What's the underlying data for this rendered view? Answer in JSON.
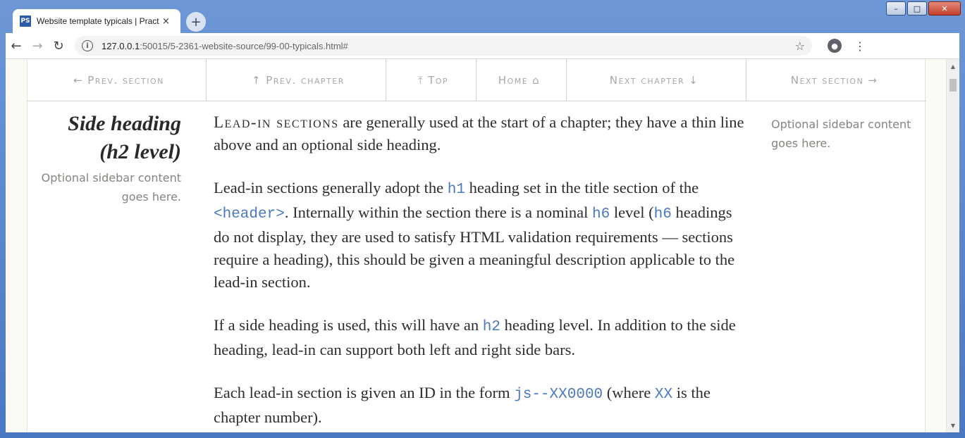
{
  "browser": {
    "tab": {
      "favicon": "PS",
      "title": "Website template typicals | Practi",
      "close": "×"
    },
    "new_tab": "+",
    "window_controls": {
      "minimize": "–",
      "maximize": "□",
      "close": "✕"
    },
    "nav": {
      "back": "←",
      "forward": "→",
      "reload": "↻"
    },
    "url_host": "127.0.0.1",
    "url_rest": ":50015/5-2361-website-source/99-00-typicals.html#",
    "icons": [
      "info-icon",
      "star-icon",
      "account-icon",
      "menu-icon"
    ]
  },
  "page_nav": [
    {
      "label": "Prev. section",
      "arrow_before": "←",
      "arrow_after": ""
    },
    {
      "label": "Prev. chapter",
      "arrow_before": "↑",
      "arrow_after": ""
    },
    {
      "label": "Top",
      "arrow_before": "⤒",
      "arrow_after": ""
    },
    {
      "label": "Home",
      "arrow_before": "",
      "arrow_after": "⌂"
    },
    {
      "label": "Next chapter",
      "arrow_before": "",
      "arrow_after": "↓"
    },
    {
      "label": "Next section",
      "arrow_before": "",
      "arrow_after": "→"
    }
  ],
  "side_heading_line1": "Side heading",
  "side_heading_line2": "(h2 level)",
  "sidebar_left_line1": "Optional sidebar content",
  "sidebar_left_line2": "goes here.",
  "sidebar_right_line1": "Optional sidebar content",
  "sidebar_right_line2": "goes here.",
  "content": {
    "p1_lead": "Lead-in sections",
    "p1_rest": " are generally used at the start of a chapter; they have a thin line above and an optional side heading.",
    "p2_a": "Lead-in sections generally adopt the ",
    "p2_code1": "h1",
    "p2_b": " heading set in the title section of the ",
    "p2_code2": "<header>",
    "p2_c": ". Internally within the section there is a nominal ",
    "p2_code3": "h6",
    "p2_d": " level (",
    "p2_code4": "h6",
    "p2_e": " headings do not display, they are used to satisfy HTML validation require­ments — sections require a heading), this should be given a meaningful de­scription applicable to the lead-in section.",
    "p3_a": "If a side heading is used, this will have an ",
    "p3_code": "h2",
    "p3_b": " heading level. In addition to the side heading, lead-in can support both left and right side bars.",
    "p4_a": "Each lead-in section is given an ID in the form ",
    "p4_code1": "js--XX0000",
    "p4_b": " (where ",
    "p4_code2": "XX",
    "p4_c": " is the chapter number)."
  }
}
